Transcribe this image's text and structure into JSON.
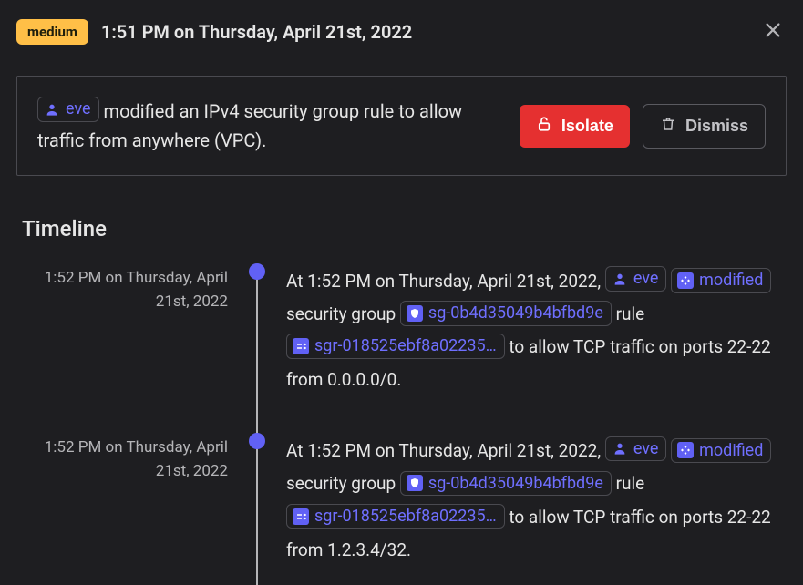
{
  "header": {
    "severity": "medium",
    "timestamp": "1:51 PM on Thursday, April 21st, 2022"
  },
  "alert": {
    "actor": "eve",
    "message_part1": " modified an IPv4 security group rule to allow traffic from anywhere (VPC).",
    "actions": {
      "isolate": "Isolate",
      "dismiss": "Dismiss"
    }
  },
  "timeline": {
    "title": "Timeline",
    "items": [
      {
        "time": "1:52 PM on Thursday, April 21st, 2022",
        "prefix": "At 1:52 PM on Thursday, April 21st, 2022, ",
        "actor": "eve",
        "action": "modified",
        "mid1": " security group ",
        "sg": "sg-0b4d35049b4bfbd9e",
        "mid2": " rule ",
        "sgr": "sgr-018525ebf8a02235…",
        "tail": " to allow TCP traffic on ports 22-22 from 0.0.0.0/0."
      },
      {
        "time": "1:52 PM on Thursday, April 21st, 2022",
        "prefix": "At 1:52 PM on Thursday, April 21st, 2022, ",
        "actor": "eve",
        "action": "modified",
        "mid1": " security group ",
        "sg": "sg-0b4d35049b4bfbd9e",
        "mid2": " rule ",
        "sgr": "sgr-018525ebf8a02235…",
        "tail": " to allow TCP traffic on ports 22-22 from 1.2.3.4/32."
      }
    ]
  }
}
